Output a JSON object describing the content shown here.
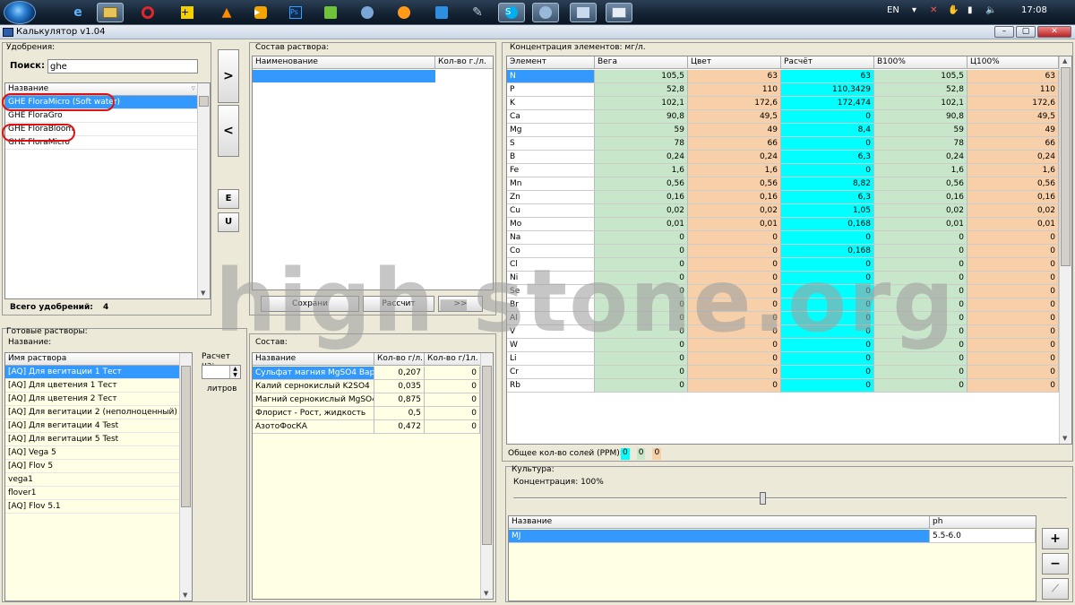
{
  "taskbar": {
    "language": "EN",
    "clock": "17:08"
  },
  "window": {
    "title": "Калькулятор v1.04"
  },
  "fertilizers": {
    "group_title": "Удобрения:",
    "search_label": "Поиск:",
    "search_value": "ghe",
    "column_header": "Название",
    "items": [
      "GHE FloraMicro (Soft water)",
      "GHE FloraGro",
      "GHE FloraBloom",
      "GHE FloraMicro"
    ],
    "total_label": "Всего удобрений:",
    "total_count": "4"
  },
  "middle_buttons": {
    "add": ">",
    "remove": "<",
    "e": "E",
    "u": "U"
  },
  "solution": {
    "group_title": "Состав раствора:",
    "col_name": "Наименование",
    "col_qty": "Кол-во г./л.",
    "save_label": "Сохрани",
    "calc_label": "Рассчит",
    "more_label": ">>"
  },
  "ready": {
    "group_title": "Готовые растворы:",
    "name_label": "Название:",
    "column_header": "Имя раствора",
    "items": [
      "[AQ] Для вегитации 1 Тест",
      "[AQ] Для цветения 1 Тест",
      "[AQ] Для цветения 2 Тест",
      "[AQ] Для вегитации 2 (неполноценный)",
      "[AQ] Для вегитации 4 Test",
      "[AQ] Для вегитации 5 Test",
      "[AQ] Vega 5",
      "[AQ] Flov 5",
      "vega1",
      "flover1",
      "[AQ] Flov 5.1"
    ],
    "calc_on_label": "Расчет на:",
    "liters_label": "литров"
  },
  "composition": {
    "group_title": "Состав:",
    "col_name": "Название",
    "col_qty": "Кол-во г/л.",
    "col_qty2": "Кол-во г/1л.",
    "rows": [
      [
        "Сульфат магния MgSO4 Вари",
        "0,207",
        "0"
      ],
      [
        "Калий сернокислый K2SO4",
        "0,035",
        "0"
      ],
      [
        "Магний сернокислый MgSO4",
        "0,875",
        "0"
      ],
      [
        "Флорист - Рост, жидкость",
        "0,5",
        "0"
      ],
      [
        "АзотоФосКА",
        "0,472",
        "0"
      ]
    ]
  },
  "concentration": {
    "group_title": "Концентрация элементов: мг/л.",
    "columns": [
      "Элемент",
      "Вега",
      "Цвет",
      "Расчёт",
      "В100%",
      "Ц100%"
    ],
    "rows": [
      [
        "N",
        "105,5",
        "63",
        "63",
        "105,5",
        "63"
      ],
      [
        "P",
        "52,8",
        "110",
        "110,3429",
        "52,8",
        "110"
      ],
      [
        "K",
        "102,1",
        "172,6",
        "172,474",
        "102,1",
        "172,6"
      ],
      [
        "Ca",
        "90,8",
        "49,5",
        "0",
        "90,8",
        "49,5"
      ],
      [
        "Mg",
        "59",
        "49",
        "8,4",
        "59",
        "49"
      ],
      [
        "S",
        "78",
        "66",
        "0",
        "78",
        "66"
      ],
      [
        "B",
        "0,24",
        "0,24",
        "6,3",
        "0,24",
        "0,24"
      ],
      [
        "Fe",
        "1,6",
        "1,6",
        "0",
        "1,6",
        "1,6"
      ],
      [
        "Mn",
        "0,56",
        "0,56",
        "8,82",
        "0,56",
        "0,56"
      ],
      [
        "Zn",
        "0,16",
        "0,16",
        "6,3",
        "0,16",
        "0,16"
      ],
      [
        "Cu",
        "0,02",
        "0,02",
        "1,05",
        "0,02",
        "0,02"
      ],
      [
        "Mo",
        "0,01",
        "0,01",
        "0,168",
        "0,01",
        "0,01"
      ],
      [
        "Na",
        "0",
        "0",
        "0",
        "0",
        "0"
      ],
      [
        "Co",
        "0",
        "0",
        "0,168",
        "0",
        "0"
      ],
      [
        "Cl",
        "0",
        "0",
        "0",
        "0",
        "0"
      ],
      [
        "Ni",
        "0",
        "0",
        "0",
        "0",
        "0"
      ],
      [
        "Se",
        "0",
        "0",
        "0",
        "0",
        "0"
      ],
      [
        "Br",
        "0",
        "0",
        "0",
        "0",
        "0"
      ],
      [
        "Al",
        "0",
        "0",
        "0",
        "0",
        "0"
      ],
      [
        "V",
        "0",
        "0",
        "0",
        "0",
        "0"
      ],
      [
        "W",
        "0",
        "0",
        "0",
        "0",
        "0"
      ],
      [
        "Li",
        "0",
        "0",
        "0",
        "0",
        "0"
      ],
      [
        "Cr",
        "0",
        "0",
        "0",
        "0",
        "0"
      ],
      [
        "Rb",
        "0",
        "0",
        "0",
        "0",
        "0"
      ]
    ],
    "col_colors": [
      "#ffffff",
      "#c8e6c9",
      "#f7cfa8",
      "#00ffff",
      "#c8e6c9",
      "#f7cfa8"
    ],
    "ppm_label": "Общее кол-во солей (PPM):",
    "ppm_values": [
      "0",
      "0",
      "0"
    ],
    "ppm_colors": [
      "#00ffff",
      "#c8e6c9",
      "#f7cfa8"
    ]
  },
  "culture": {
    "group_title": "Культура:",
    "concentration_label": "Концентрация: 100%",
    "slider_level_percent": 45,
    "col_name": "Название",
    "col_ph": "ph",
    "rows": [
      [
        "MJ",
        "5.5-6.0"
      ]
    ],
    "btn_add": "+",
    "btn_remove": "−",
    "btn_chart": "⟋"
  },
  "watermark": "high-stone.org",
  "colors": {
    "selection": "#3399ff",
    "red_circle": "#e01010"
  }
}
